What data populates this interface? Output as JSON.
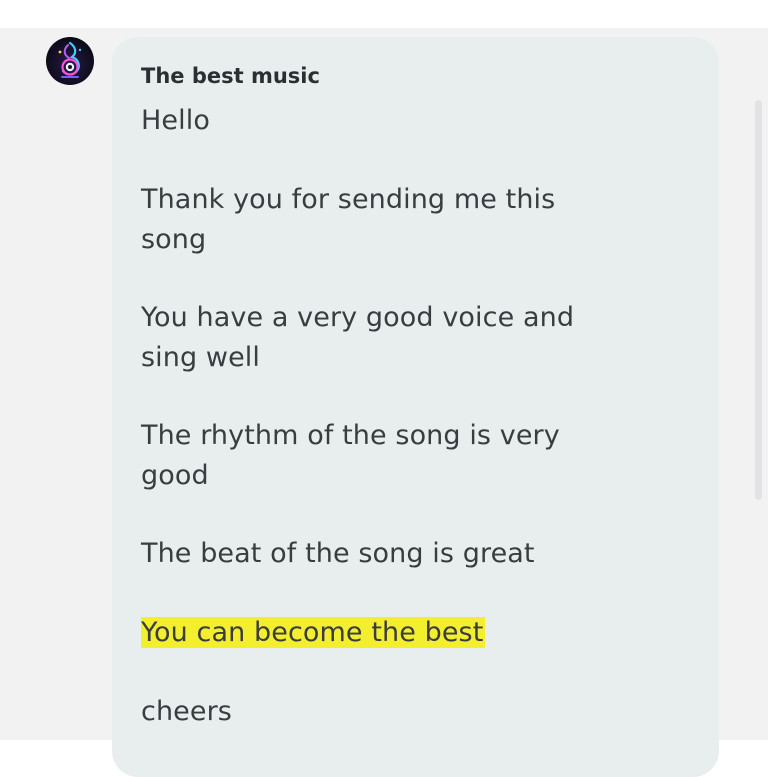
{
  "message": {
    "sender": "The best music",
    "lines": [
      "Hello",
      "Thank you for sending me this",
      "song",
      "You have a very good voice and",
      "sing well",
      "The rhythm of the song is very",
      "good",
      "The beat of the song is great",
      "You can become the best",
      "cheers"
    ]
  },
  "colors": {
    "bubble": "#e8eeed",
    "highlight": "#f3ee2e",
    "background": "#f2f2f3"
  }
}
